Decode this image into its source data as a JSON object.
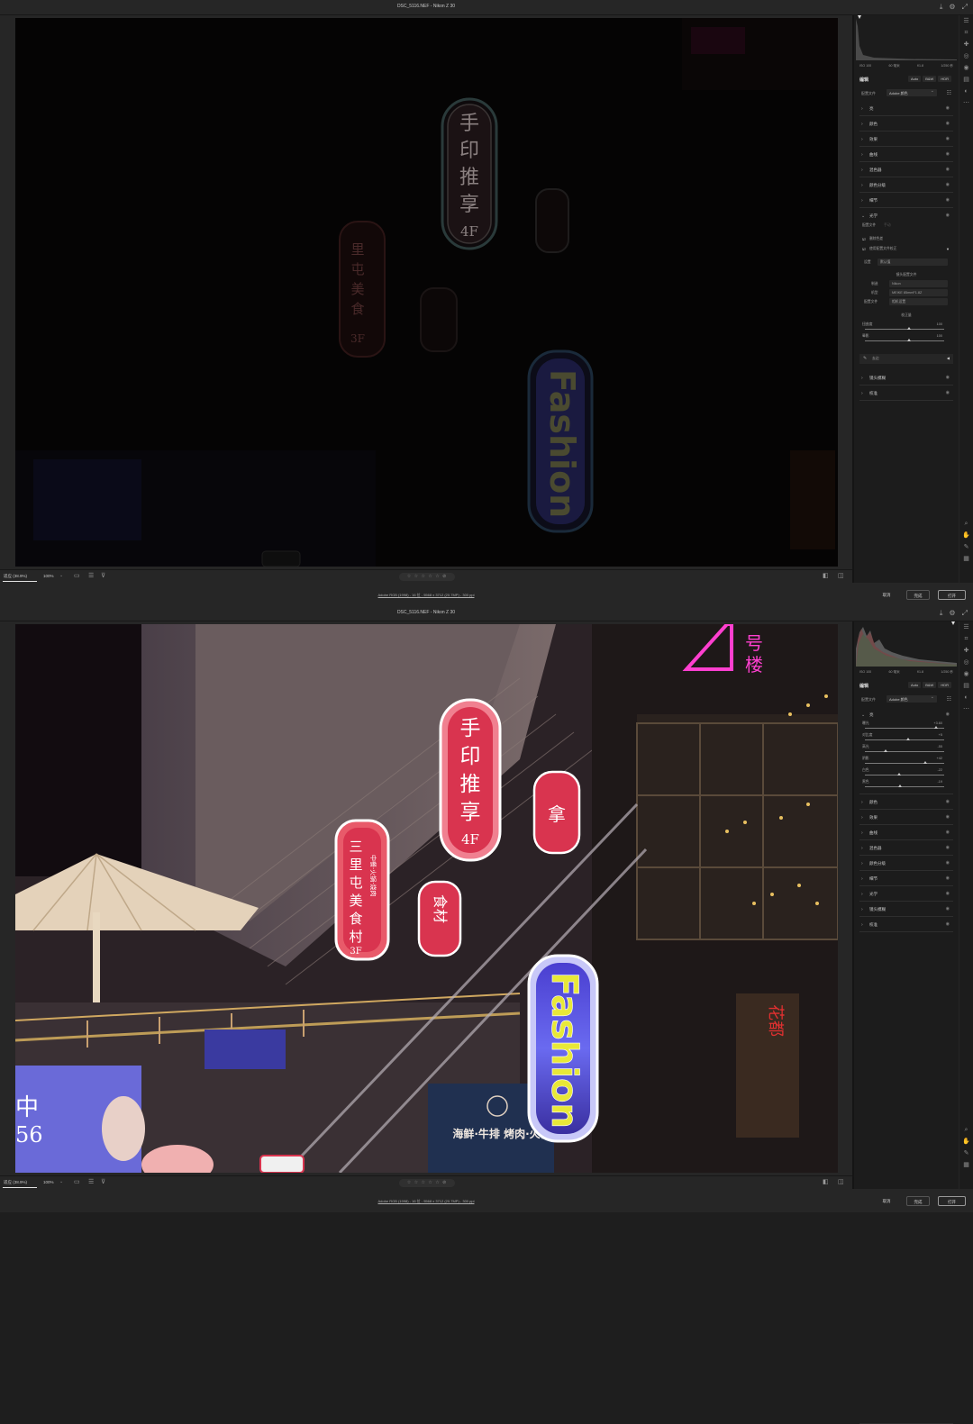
{
  "title": "DSC_5116.NEF - Nikon Z 30",
  "exif": [
    "ISO 100",
    "60 毫米",
    "f/1.8",
    "1/250 秒"
  ],
  "edit_title": "编辑",
  "modes": [
    "Auto",
    "B&W",
    "HDR"
  ],
  "profile_label": "配置文件",
  "profile_value": "Adobe 颜色",
  "sections_collapsed": [
    "亮",
    "颜色",
    "效果",
    "曲线",
    "混色器",
    "颜色分级",
    "细节"
  ],
  "optics": {
    "label": "光学",
    "profile_label": "配置文件",
    "manual_label": "手动",
    "remove_ca": "删除色差",
    "use_profile": "使用配置文件校正",
    "setup_label": "设置",
    "setup_value": "默认值",
    "lens_profile_title": "镜头配置文件",
    "make_label": "制造",
    "make_value": "Nikon",
    "model_label": "机型",
    "model_value": "MEIKE 85mmF1.8Z",
    "prof_label": "配置文件",
    "prof_value": "相机设置",
    "amount_title": "校正量",
    "distortion_label": "扭曲度",
    "distortion_value": "100",
    "vignette_label": "晕影",
    "vignette_value": "100",
    "defringe_label": "去边"
  },
  "sections_after": [
    "镜头模糊",
    "校准"
  ],
  "light_section": {
    "label": "亮",
    "sliders": [
      {
        "label": "曝光",
        "value": "+3.60"
      },
      {
        "label": "对比度",
        "value": "+5"
      },
      {
        "label": "高光",
        "value": "-55"
      },
      {
        "label": "阴影",
        "value": "+42"
      },
      {
        "label": "白色",
        "value": "-22"
      },
      {
        "label": "黑色",
        "value": "-19"
      }
    ]
  },
  "sections_after_light": [
    "颜色",
    "效果",
    "曲线",
    "混色器",
    "颜色分级",
    "细节",
    "光学",
    "镜头模糊",
    "校准"
  ],
  "bottom": {
    "zoom_fit": "适应 (38.9%)",
    "zoom_100": "100%",
    "stars": "☆ ☆ ☆ ☆ ☆ ⊘"
  },
  "footer": {
    "info": "Adobe RGB (1998) - 16 位 - 5568 x 3712 (20.7MP) - 300 ppi",
    "cancel": "取消",
    "done": "完成",
    "open": "打开"
  },
  "signs": {
    "shouyin": [
      "手",
      "印",
      "推",
      "享",
      "4F"
    ],
    "sanli": [
      "三",
      "里",
      "屯",
      "美",
      "食",
      "村",
      "3F"
    ],
    "sanli_sub": "中餐·火锅·烧肉",
    "fashion": "Fashion",
    "haolou": [
      "号",
      "楼"
    ],
    "seafood": "海鲜·牛排\n烤肉·火锅",
    "huadu": "花都",
    "zhong": "中",
    "num56": "56",
    "na": "拿",
    "shi": "食材"
  },
  "colors": {
    "accent_red": "#d9344f",
    "fashion_blue": "#5a4fd9",
    "fashion_yellow": "#e8e838",
    "magenta_sign": "#ff3fcf",
    "panel_bg": "#1c1c1c"
  }
}
